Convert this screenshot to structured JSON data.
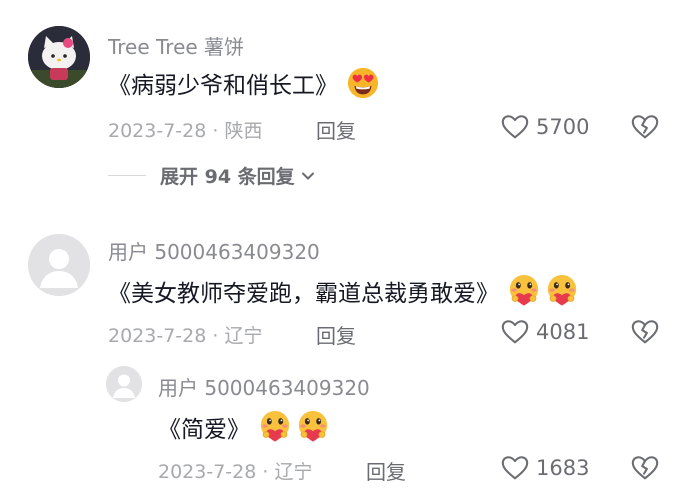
{
  "comments": [
    {
      "username": "Tree Tree 薯饼",
      "text": "《病弱少爷和俏长工》",
      "emoji": [
        "heart-eyes-emoji"
      ],
      "date_location": "2023-7-28 · 陕西",
      "reply_label": "回复",
      "likes": "5700",
      "expand_label": "展开 94 条回复"
    },
    {
      "username": "用户 5000463409320",
      "text": "《美女教师夺爱跑，霸道总裁勇敢爱》",
      "emoji": [
        "heart-hug-emoji",
        "heart-hug-emoji"
      ],
      "date_location": "2023-7-28 · 辽宁",
      "reply_label": "回复",
      "likes": "4081"
    }
  ],
  "sub_reply": {
    "username": "用户 5000463409320",
    "text": "《简爱》",
    "emoji": [
      "heart-hug-emoji",
      "heart-hug-emoji"
    ],
    "date_location": "2023-7-28 · 辽宁",
    "reply_label": "回复",
    "likes": "1683"
  },
  "colors": {
    "meta_gray": "#a8a9ad",
    "text_dark": "#161823"
  }
}
